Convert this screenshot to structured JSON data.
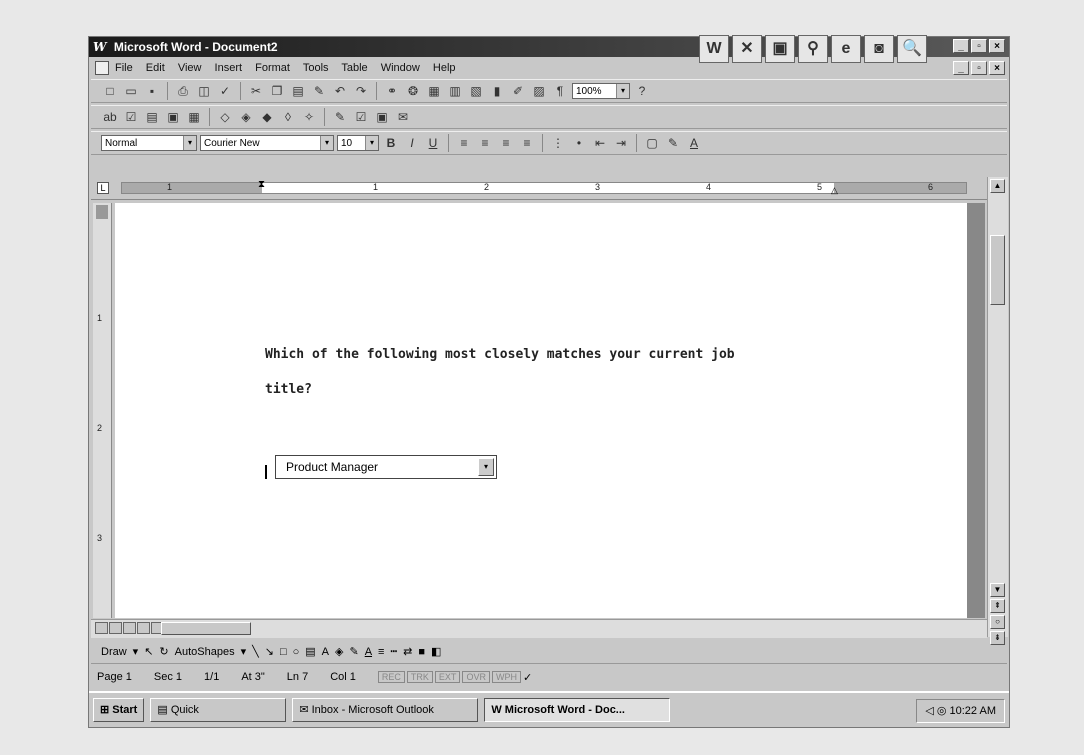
{
  "window": {
    "title": "Microsoft Word - Document2"
  },
  "menu": [
    "File",
    "Edit",
    "View",
    "Insert",
    "Format",
    "Tools",
    "Table",
    "Window",
    "Help"
  ],
  "toolbar": {
    "zoom": "100%",
    "style": "Normal",
    "font": "Courier New",
    "size": "10"
  },
  "ruler": {
    "numbers": [
      "1",
      "1",
      "2",
      "3",
      "4",
      "5",
      "6"
    ]
  },
  "vruler": {
    "numbers": [
      "1",
      "2",
      "3"
    ]
  },
  "document": {
    "question_line1": "Which of the following most closely matches your current job",
    "question_line2": "title?",
    "dropdown_value": "Product Manager"
  },
  "drawbar": {
    "draw": "Draw",
    "autoshapes": "AutoShapes"
  },
  "status": {
    "page": "Page 1",
    "sec": "Sec 1",
    "pages": "1/1",
    "at": "At 3\"",
    "ln": "Ln 7",
    "col": "Col 1",
    "rec": "REC",
    "trk": "TRK",
    "ext": "EXT",
    "ovr": "OVR",
    "wph": "WPH"
  },
  "taskbar": {
    "start": "Start",
    "quick": "Quick",
    "outlook": "Inbox - Microsoft Outlook",
    "word": "Microsoft Word - Doc...",
    "clock": "10:22 AM"
  }
}
